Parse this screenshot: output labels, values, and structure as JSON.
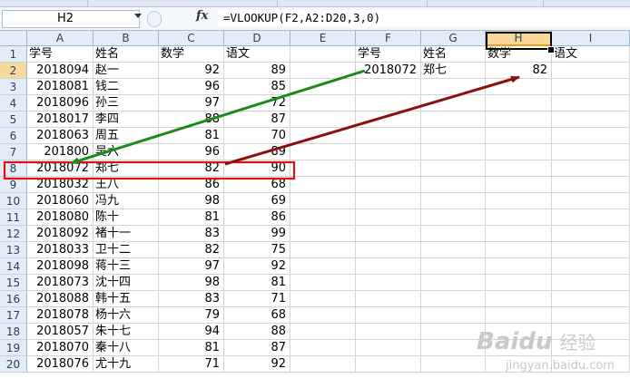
{
  "name_box": "H2",
  "formula": "=VLOOKUP(F2,A2:D20,3,0)",
  "fx_label": "fx",
  "columns": [
    "A",
    "B",
    "C",
    "D",
    "E",
    "F",
    "G",
    "H",
    "I"
  ],
  "rows": [
    "1",
    "2",
    "3",
    "4",
    "5",
    "6",
    "7",
    "8",
    "9",
    "10",
    "11",
    "12",
    "13",
    "14",
    "15",
    "16",
    "17",
    "18",
    "19",
    "20"
  ],
  "headers": {
    "a": "学号",
    "b": "姓名",
    "c": "数学",
    "d": "语文"
  },
  "table": [
    [
      "2018094",
      "赵一",
      "92",
      "89"
    ],
    [
      "2018081",
      "钱二",
      "96",
      "85"
    ],
    [
      "2018096",
      "孙三",
      "97",
      "72"
    ],
    [
      "2018017",
      "李四",
      "88",
      "87"
    ],
    [
      "2018063",
      "周五",
      "81",
      "70"
    ],
    [
      "201800",
      "吴六",
      "96",
      "89"
    ],
    [
      "2018072",
      "郑七",
      "82",
      "90"
    ],
    [
      "2018032",
      "王八",
      "86",
      "68"
    ],
    [
      "2018060",
      "冯九",
      "98",
      "69"
    ],
    [
      "2018080",
      "陈十",
      "81",
      "86"
    ],
    [
      "2018092",
      "褚十一",
      "83",
      "99"
    ],
    [
      "2018033",
      "卫十二",
      "82",
      "75"
    ],
    [
      "2018098",
      "蒋十三",
      "97",
      "92"
    ],
    [
      "2018073",
      "沈十四",
      "98",
      "81"
    ],
    [
      "2018088",
      "韩十五",
      "83",
      "71"
    ],
    [
      "2018078",
      "杨十六",
      "79",
      "68"
    ],
    [
      "2018057",
      "朱十七",
      "94",
      "88"
    ],
    [
      "2018070",
      "秦十八",
      "81",
      "87"
    ],
    [
      "2018076",
      "尤十九",
      "71",
      "92"
    ]
  ],
  "lookup": {
    "header_f": "学号",
    "header_g": "姓名",
    "header_h": "数学",
    "header_i": "语文",
    "f2": "2018072",
    "g2": "郑七",
    "h2": "82"
  },
  "watermark": {
    "logo": "Baidu",
    "cn": "经验",
    "url": "jingyan.baidu.com"
  },
  "colors": {
    "highlight_box": "#e01010",
    "arrow_green": "#1a8a1a",
    "arrow_darkred": "#8b0f0f"
  }
}
